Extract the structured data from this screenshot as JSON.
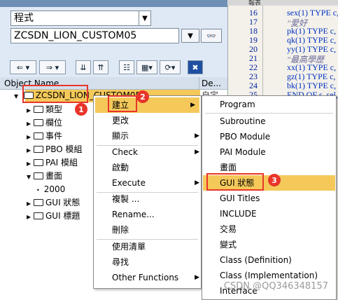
{
  "left_panel": {
    "object_type_select": "程式",
    "object_name_input": "ZCSDN_LION_CUSTOM05"
  },
  "toolbar_icons": [
    "arrow-left-icon",
    "arrow-right-icon",
    "collapse-icon",
    "expand-icon",
    "hierarchy-icon",
    "find-icon",
    "refresh-icon",
    "close-icon"
  ],
  "tree_header": {
    "object_name": "Object Name",
    "description": "De..."
  },
  "tree": {
    "root": "ZCSDN_LION_CUSTOM05",
    "root_desc": "自定…",
    "items": [
      {
        "label": "類型",
        "expanded": false
      },
      {
        "label": "欄位",
        "expanded": false
      },
      {
        "label": "事件",
        "expanded": false
      },
      {
        "label": "PBO 模組",
        "expanded": false
      },
      {
        "label": "PAI 模組",
        "expanded": false
      },
      {
        "label": "畫面",
        "expanded": true
      },
      {
        "label": "2000",
        "expanded": false,
        "leaf": true
      },
      {
        "label": "GUI 狀態",
        "expanded": false
      },
      {
        "label": "GUI 標題",
        "expanded": false
      }
    ]
  },
  "context_menu": {
    "items": [
      {
        "label": "建立",
        "submenu": true
      },
      {
        "label": "更改",
        "submenu": false
      },
      {
        "label": "顯示",
        "submenu": true
      },
      {
        "label": "Check",
        "submenu": true
      },
      {
        "label": "啟動",
        "submenu": false
      },
      {
        "label": "Execute",
        "submenu": true
      },
      {
        "label": "複製 ...",
        "submenu": false
      },
      {
        "label": "Rename...",
        "submenu": false
      },
      {
        "label": "刪除",
        "submenu": false
      },
      {
        "label": "使用清單",
        "submenu": false
      },
      {
        "label": "尋找",
        "submenu": false
      },
      {
        "label": "Other Functions",
        "submenu": true
      }
    ]
  },
  "submenu": {
    "items": [
      "Program",
      "Subroutine",
      "PBO Module",
      "PAI Module",
      "畫面",
      "GUI 狀態",
      "GUI Titles",
      "INCLUDE",
      "交易",
      "變式",
      "Class (Definition)",
      "Class (Implementation)",
      "Interface"
    ]
  },
  "badges": [
    "1",
    "2",
    "3"
  ],
  "code_panel": {
    "header": "報表",
    "line_numbers": [
      "16",
      "17",
      "18",
      "19",
      "20",
      "21",
      "22",
      "23",
      "24",
      "25"
    ],
    "lines": [
      "sex(1) TYPE c,",
      "\"愛好",
      "pk(1) TYPE c,",
      "qk(1) TYPE c,",
      "yy(1) TYPE c,",
      "\"最高學歷",
      "xx(1) TYPE c,",
      "gz(1) TYPE c,",
      "bk(1) TYPE c,",
      "END OF s_sel,"
    ]
  },
  "watermark": "CSDN @QQ346348157",
  "colors": {
    "highlight": "#f4c95a",
    "annotation_red": "#e8352a",
    "panel_bg": "#dfe9f5"
  }
}
